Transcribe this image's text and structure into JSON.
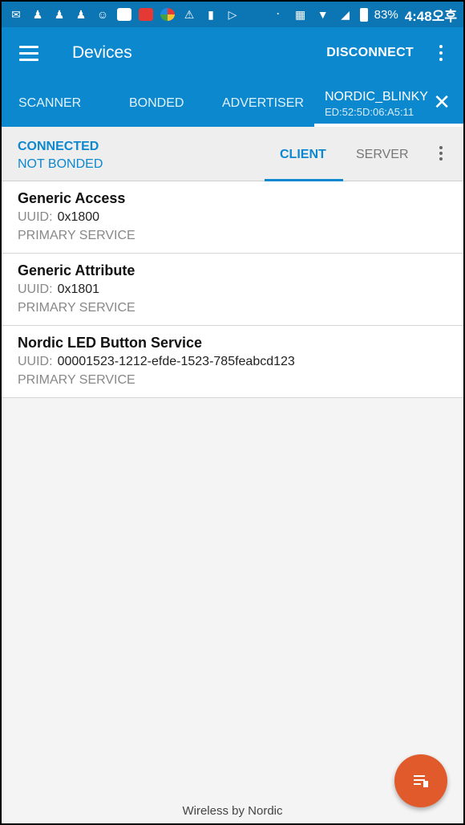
{
  "status_bar": {
    "battery": "83%",
    "time": "4:48오후"
  },
  "app_bar": {
    "title": "Devices",
    "action": "DISCONNECT"
  },
  "tabs": {
    "items": [
      "SCANNER",
      "BONDED",
      "ADVERTISER"
    ],
    "active": {
      "name": "NORDIC_BLINKY",
      "address": "ED:52:5D:06:A5:11"
    }
  },
  "connection": {
    "status": "CONNECTED",
    "bond": "NOT BONDED",
    "client_tab": "CLIENT",
    "server_tab": "SERVER"
  },
  "services": [
    {
      "name": "Generic Access",
      "uuid_label": "UUID:",
      "uuid": "0x1800",
      "type": "PRIMARY SERVICE"
    },
    {
      "name": "Generic Attribute",
      "uuid_label": "UUID:",
      "uuid": "0x1801",
      "type": "PRIMARY SERVICE"
    },
    {
      "name": "Nordic LED Button Service",
      "uuid_label": "UUID:",
      "uuid": "00001523-1212-efde-1523-785feabcd123",
      "type": "PRIMARY SERVICE"
    }
  ],
  "footer": {
    "text": "Wireless by Nordic"
  },
  "colors": {
    "primary": "#0c88cf",
    "status_bar": "#0c75b4",
    "fab": "#e15a2b"
  }
}
